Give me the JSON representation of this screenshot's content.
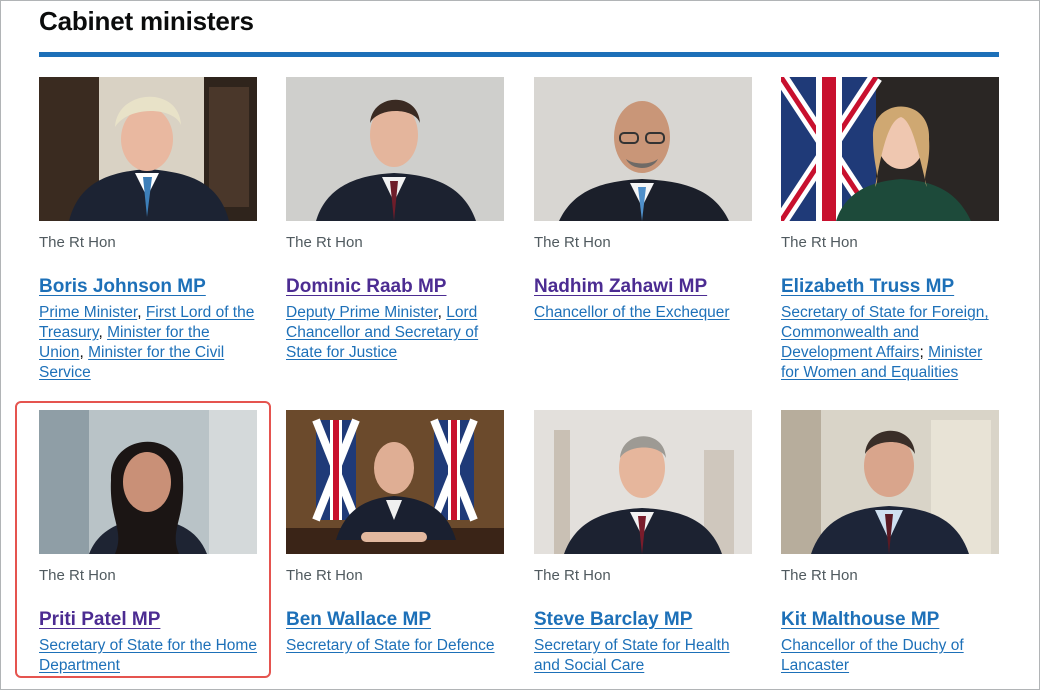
{
  "page": {
    "title": "Cabinet ministers"
  },
  "colors": {
    "accent": "#1d70b8",
    "visited": "#4c2c92",
    "highlight": "#e5544f"
  },
  "ministers": [
    {
      "honorific": "The Rt Hon",
      "name": "Boris Johnson MP",
      "visited": false,
      "roles": [
        "Prime Minister",
        "First Lord of the Treasury",
        "Minister for the Union",
        "Minister for the Civil Service"
      ]
    },
    {
      "honorific": "The Rt Hon",
      "name": "Dominic Raab MP",
      "visited": true,
      "roles": [
        "Deputy Prime Minister",
        "Lord Chancellor and Secretary of State for Justice"
      ]
    },
    {
      "honorific": "The Rt Hon",
      "name": "Nadhim Zahawi MP",
      "visited": true,
      "roles": [
        "Chancellor of the Exchequer"
      ]
    },
    {
      "honorific": "The Rt Hon",
      "name": "Elizabeth Truss MP",
      "visited": false,
      "roles": [
        "Secretary of State for Foreign, Commonwealth and Development Affairs",
        "Minister for Women and Equalities"
      ]
    },
    {
      "honorific": "The Rt Hon",
      "name": "Priti Patel MP",
      "visited": true,
      "highlighted": true,
      "roles": [
        "Secretary of State for the Home Department"
      ]
    },
    {
      "honorific": "The Rt Hon",
      "name": "Ben Wallace MP",
      "visited": false,
      "roles": [
        "Secretary of State for Defence"
      ]
    },
    {
      "honorific": "The Rt Hon",
      "name": "Steve Barclay MP",
      "visited": false,
      "roles": [
        "Secretary of State for Health and Social Care"
      ]
    },
    {
      "honorific": "The Rt Hon",
      "name": "Kit Malthouse MP",
      "visited": false,
      "roles": [
        "Chancellor of the Duchy of Lancaster"
      ]
    }
  ]
}
